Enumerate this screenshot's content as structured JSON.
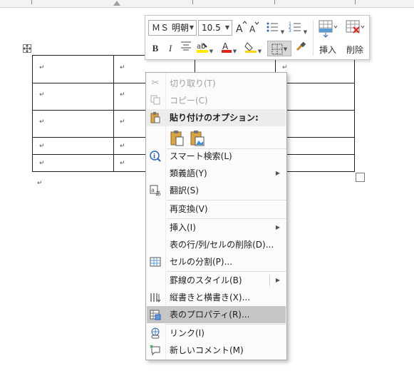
{
  "colors": {
    "menu_bg": "#fbfbfb",
    "menu_highlight": "#c6c6c6",
    "disabled_text": "#a0a0a0",
    "highlight_yellow": "#ffea00",
    "font_color_red": "#e0231b",
    "fill_yellow": "#ffd400",
    "accent_blue": "#2a63b8"
  },
  "table": {
    "cell_mark": "↵",
    "para_mark": "↵"
  },
  "mini_toolbar": {
    "font_name": "ＭＳ 明朝",
    "font_size": "10.5",
    "insert_label": "挿入",
    "delete_label": "削除",
    "icons": [
      "grow-font-icon",
      "shrink-font-icon",
      "bullets-icon",
      "numbering-icon",
      "insert-table-icon",
      "delete-table-icon",
      "bold-icon",
      "italic-icon",
      "center-align-icon",
      "highlight-icon",
      "font-color-icon",
      "shading-icon",
      "borders-icon",
      "format-painter-icon"
    ],
    "bold": "B",
    "italic": "I"
  },
  "context_menu": {
    "items": [
      {
        "label": "切り取り(T)",
        "icon": "scissors-icon",
        "enabled": false
      },
      {
        "label": "コピー(C)",
        "icon": "copy-icon",
        "enabled": false
      },
      {
        "label": "貼り付けのオプション:",
        "icon": "paste-icon",
        "enabled": true
      },
      {
        "label": "スマート検索(L)",
        "icon": "info-search-icon",
        "enabled": true
      },
      {
        "label": "類義語(Y)",
        "icon": "",
        "enabled": true,
        "submenu": true
      },
      {
        "label": "翻訳(S)",
        "icon": "translate-icon",
        "enabled": true
      },
      {
        "label": "再変換(V)",
        "icon": "",
        "enabled": true
      },
      {
        "label": "挿入(I)",
        "icon": "",
        "enabled": true,
        "submenu": true
      },
      {
        "label": "表の行/列/セルの削除(D)...",
        "icon": "",
        "enabled": true
      },
      {
        "label": "セルの分割(P)...",
        "icon": "split-cells-icon",
        "enabled": true
      },
      {
        "label": "罫線のスタイル(B)",
        "icon": "",
        "enabled": true,
        "submenu": true
      },
      {
        "label": "縦書きと横書き(X)...",
        "icon": "text-direction-icon",
        "enabled": true
      },
      {
        "label": "表のプロパティ(R)...",
        "icon": "table-properties-icon",
        "enabled": true,
        "highlighted": true
      },
      {
        "label": "リンク(I)",
        "icon": "link-icon",
        "enabled": true
      },
      {
        "label": "新しいコメント(M)",
        "icon": "new-comment-icon",
        "enabled": true
      }
    ]
  }
}
